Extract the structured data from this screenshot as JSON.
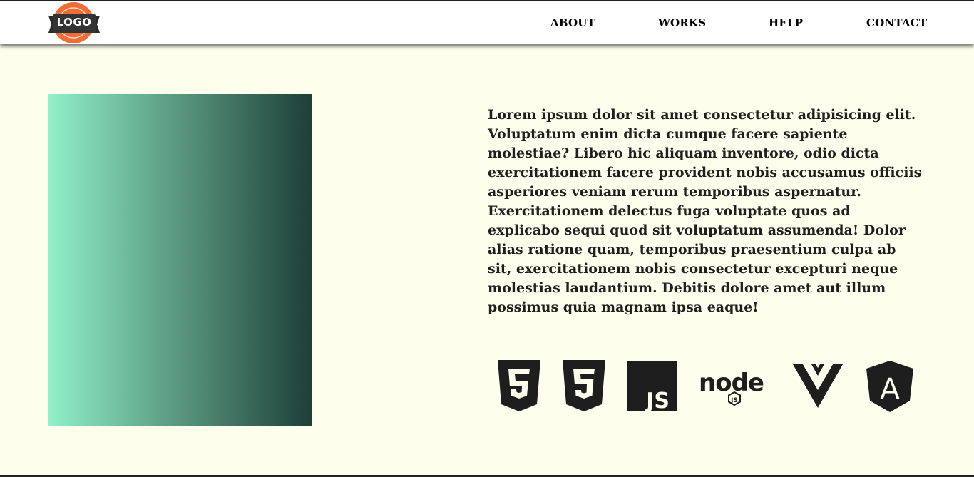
{
  "header": {
    "logo_text": "LOGO",
    "nav": {
      "about": "ABOUT",
      "works": "WORKS",
      "help": "HELP",
      "contact": "CONTACT"
    }
  },
  "main": {
    "paragraph": "Lorem ipsum dolor sit amet consectetur adipisicing elit. Voluptatum enim dicta cumque facere sapiente molestiae? Libero hic aliquam inventore, odio dicta exercitationem facere provident nobis accusamus officiis asperiores veniam rerum temporibus aspernatur. Exercitationem delectus fuga voluptate quos ad explicabo sequi quod sit voluptatum assumenda! Dolor alias ratione quam, temporibus praesentium culpa ab sit, exercitationem nobis consectetur excepturi neque molestias laudantium. Debitis dolore amet aut illum possimus quia magnam ipsa eaque!",
    "tech_icons": [
      "html5-icon",
      "css3-icon",
      "javascript-icon",
      "nodejs-icon",
      "vuejs-icon",
      "angular-icon"
    ],
    "js_label": "JS",
    "node_label": "node",
    "angular_label": "A"
  },
  "colors": {
    "background": "#fdfeec",
    "gradient_start": "#91f0c9",
    "gradient_end": "#1d3f37",
    "logo_orange": "#f26c3a",
    "text": "#1f1f1f",
    "icon": "#1e1e1e"
  }
}
